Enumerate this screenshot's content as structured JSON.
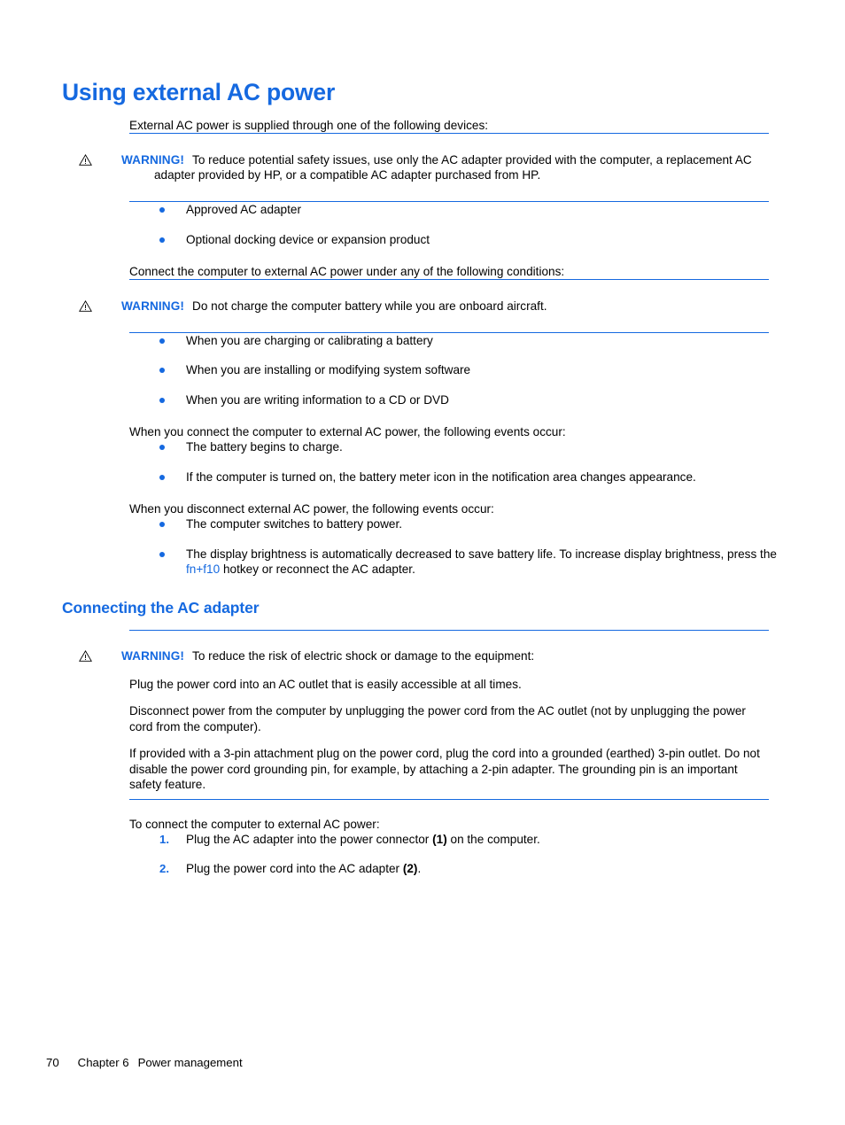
{
  "page": {
    "title": "Using external AC power",
    "intro": "External AC power is supplied through one of the following devices:"
  },
  "warning_icon_name": "warning-triangle-icon",
  "warning_label": "WARNING!",
  "warnings": {
    "adapter": {
      "label": "WARNING!",
      "text": "To reduce potential safety issues, use only the AC adapter provided with the computer, a replacement AC adapter provided by HP, or a compatible AC adapter purchased from HP."
    },
    "aircraft": {
      "label": "WARNING!",
      "text": "Do not charge the computer battery while you are onboard aircraft."
    },
    "shock": {
      "label": "WARNING!",
      "text": "To reduce the risk of electric shock or damage to the equipment:",
      "para1": "Plug the power cord into an AC outlet that is easily accessible at all times.",
      "para2": "Disconnect power from the computer by unplugging the power cord from the AC outlet (not by unplugging the power cord from the computer).",
      "para3": "If provided with a 3-pin attachment plug on the power cord, plug the cord into a grounded (earthed) 3-pin outlet. Do not disable the power cord grounding pin, for example, by attaching a 2-pin adapter. The grounding pin is an important safety feature."
    }
  },
  "devices_list": [
    "Approved AC adapter",
    "Optional docking device or expansion product"
  ],
  "connect_intro": "Connect the computer to external AC power under any of the following conditions:",
  "conditions_list": [
    "When you are charging or calibrating a battery",
    "When you are installing or modifying system software",
    "When you are writing information to a CD or DVD"
  ],
  "connect_events_intro": "When you connect the computer to external AC power, the following events occur:",
  "connect_events": [
    "The battery begins to charge.",
    "If the computer is turned on, the battery meter icon in the notification area changes appearance."
  ],
  "disconnect_events_intro": "When you disconnect external AC power, the following events occur:",
  "disconnect_events": {
    "item1": "The computer switches to battery power.",
    "item2_part1": "The display brightness is automatically decreased to save battery life. To increase display brightness, press the ",
    "item2_hotkey": "fn+f10",
    "item2_part2": " hotkey or reconnect the AC adapter."
  },
  "section2": {
    "heading": "Connecting the AC adapter",
    "steps_intro": "To connect the computer to external AC power:",
    "steps": [
      {
        "number": "1.",
        "part1": "Plug the AC adapter into the power connector ",
        "ref": "(1)",
        "part2": " on the computer."
      },
      {
        "number": "2.",
        "part1": "Plug the power cord into the AC adapter ",
        "ref": "(2)",
        "part2": "."
      }
    ]
  },
  "footer": {
    "page_number": "70",
    "chapter": "Chapter 6",
    "chapter_title": "Power management"
  },
  "colors": {
    "accent_blue": "#1569E0",
    "text": "#000000",
    "background": "#FFFFFF"
  }
}
